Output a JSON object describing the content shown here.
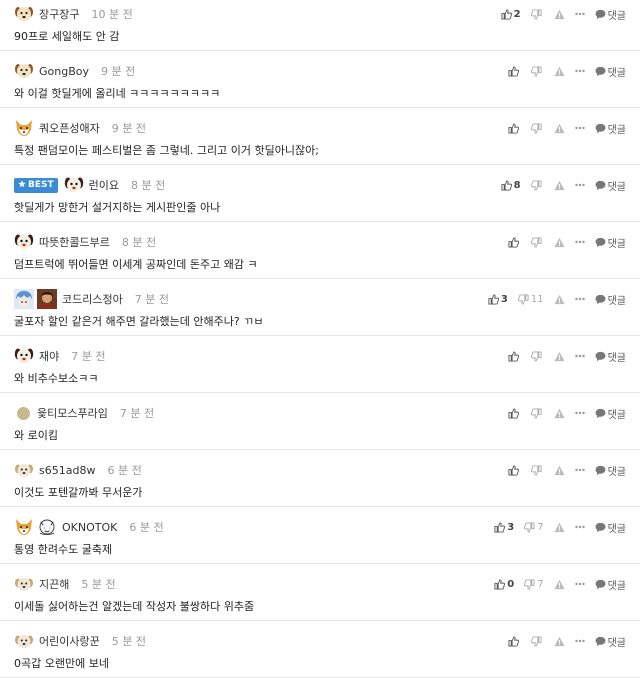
{
  "comments": [
    {
      "avatar": "dog",
      "nick": "장구장구",
      "time": "10 분 전",
      "text": "90프로 세일해도 안 감",
      "like": "2",
      "dislike": ""
    },
    {
      "avatar": "dog",
      "nick": "GongBoy",
      "time": "9 분 전",
      "text": "와 이걸 핫딜게에 올리네 ㅋㅋㅋㅋㅋㅋㅋㅋㅋ",
      "like": "",
      "dislike": ""
    },
    {
      "avatar": "fox",
      "nick": "쿼오픈성애자",
      "time": "9 분 전",
      "text": "특정 팬덤모이는 페스티벌은 좀 그렇네. 그리고 이거 핫딜아니잖아;",
      "like": "",
      "dislike": ""
    },
    {
      "best": "BEST",
      "avatar": "dog-dark",
      "nick": "런이요",
      "time": "8 분 전",
      "text": "핫딜게가 망한거 설거지하는 게시판인줄 아나",
      "like": "8",
      "dislike": ""
    },
    {
      "avatar": "dog-dark",
      "nick": "따뜻한콜드부르",
      "time": "8 분 전",
      "text": "덤프트럭에 뛰어들면 이세계 공짜인데 돈주고 왜감 ㅋ",
      "like": "",
      "dislike": ""
    },
    {
      "avatar": "anime",
      "avatar2": "portrait",
      "nick": "코드리스정아",
      "time": "7 분 전",
      "text": "굴포자 할인 같은거 해주면 갈라했는데 안해주나? ㄲㅂ",
      "like": "3",
      "dislike": "11"
    },
    {
      "avatar": "dog-dark",
      "nick": "재야",
      "time": "7 분 전",
      "text": "와 비추수보소ㅋㅋ",
      "like": "",
      "dislike": ""
    },
    {
      "avatar": "dot",
      "nick": "윷티모스푸라임",
      "time": "7 분 전",
      "text": "와 로이킴",
      "like": "",
      "dislike": ""
    },
    {
      "avatar": "dog-light",
      "nick": "s651ad8w",
      "time": "6 분 전",
      "text": "이것도 포텐갈까봐 무서운가",
      "like": "",
      "dislike": ""
    },
    {
      "avatar": "fox",
      "avatar2": "sketch",
      "nick": "OKNOTOK",
      "time": "6 분 전",
      "text": "통영 한려수도 굴축제",
      "like": "3",
      "dislike": "7"
    },
    {
      "avatar": "dog-light",
      "nick": "지끈해",
      "time": "5 분 전",
      "text": "이세돌 싫어하는건 알겠는데 작성자 불쌍하다 위추줌",
      "like": "0",
      "dislike": "7"
    },
    {
      "avatar": "dog-light",
      "nick": "어린이사랑꾼",
      "time": "5 분 전",
      "text": "0곡갑 오랜만에 보네",
      "like": "",
      "dislike": ""
    }
  ],
  "actions": {
    "reply_label": "댓글"
  },
  "icons": [
    "thumbs-up-icon",
    "thumbs-down-icon",
    "warning-icon",
    "more-icon",
    "reply-bubble-icon"
  ]
}
